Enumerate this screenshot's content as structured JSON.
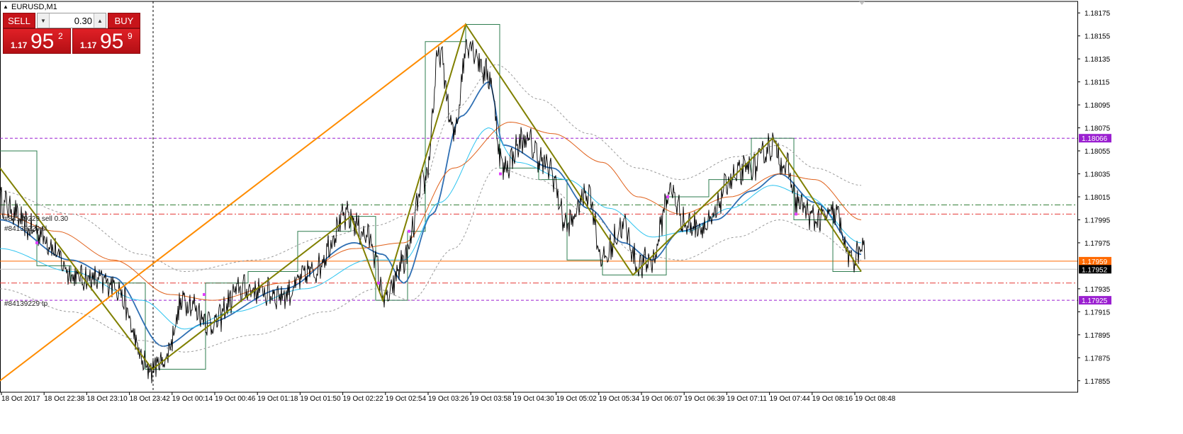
{
  "window": {
    "title": "EURUSD,M1",
    "symbol_triangle": "▲"
  },
  "one_click_trading": {
    "sell_label": "SELL",
    "buy_label": "BUY",
    "lot_value": "0.30",
    "lot_down_glyph": "▼",
    "lot_up_glyph": "▲",
    "bid": {
      "prefix": "1.17",
      "big": "95",
      "sup": "2"
    },
    "ask": {
      "prefix": "1.17",
      "big": "95",
      "sup": "9"
    }
  },
  "order_labels": {
    "entry": "#84139229 sell 0.30",
    "sl": "#84139229 sl",
    "tp": "#84139229 tp"
  },
  "price_axis": {
    "ticks": [
      "1.18175",
      "1.18155",
      "1.18135",
      "1.18115",
      "1.18095",
      "1.18075",
      "1.18055",
      "1.18035",
      "1.18015",
      "1.17995",
      "1.17975",
      "1.17935",
      "1.17915",
      "1.17895",
      "1.17875",
      "1.17855"
    ],
    "tick_values": [
      1.18175,
      1.18155,
      1.18135,
      1.18115,
      1.18095,
      1.18075,
      1.18055,
      1.18035,
      1.18015,
      1.17995,
      1.17975,
      1.17935,
      1.17915,
      1.17895,
      1.17875,
      1.17855
    ],
    "badges": [
      {
        "name": "level-upper",
        "label": "1.18066",
        "value": 1.18066,
        "color": "#9a1fd0",
        "text_color": "#ffffff"
      },
      {
        "name": "ask-line",
        "label": "1.17959",
        "value": 1.17959,
        "color": "#ff6a00",
        "text_color": "#ffffff"
      },
      {
        "name": "bid-line",
        "label": "1.17952",
        "value": 1.17952,
        "color": "#000000",
        "text_color": "#ffffff"
      },
      {
        "name": "level-lower",
        "label": "1.17925",
        "value": 1.17925,
        "color": "#9a1fd0",
        "text_color": "#ffffff"
      }
    ]
  },
  "time_axis": {
    "labels": [
      "18 Oct 2017",
      "18 Oct 22:38",
      "18 Oct 23:10",
      "18 Oct 23:42",
      "19 Oct 00:14",
      "19 Oct 00:46",
      "19 Oct 01:18",
      "19 Oct 01:50",
      "19 Oct 02:22",
      "19 Oct 02:54",
      "19 Oct 03:26",
      "19 Oct 03:58",
      "19 Oct 04:30",
      "19 Oct 05:02",
      "19 Oct 05:34",
      "19 Oct 06:07",
      "19 Oct 06:39",
      "19 Oct 07:11",
      "19 Oct 07:44",
      "19 Oct 08:16",
      "19 Oct 08:48"
    ]
  },
  "colors": {
    "background": "#ffffff",
    "price": "#000000",
    "zigzag": "#808000",
    "trendline": "#ff8c00",
    "ma_fast": "#2f6fb3",
    "ma_light": "#2ec4f0",
    "ma_orange": "#e0601a",
    "envelope": "#9a9a9a",
    "levels": "#9a1fd0",
    "entry": "#2e7d32",
    "sl_tp": "#e53935",
    "channel_box": "#2e7d4f",
    "marker": "#e040fb"
  },
  "chart_data": {
    "type": "line",
    "symbol": "EURUSD",
    "timeframe": "M1",
    "ylim": [
      1.17845,
      1.18185
    ],
    "grid": false,
    "hlines": [
      {
        "name": "resistance",
        "value": 1.18066,
        "style": "dashed",
        "color": "#9a1fd0"
      },
      {
        "name": "entry",
        "value": 1.18008,
        "style": "dashdot",
        "color": "#2e7d32"
      },
      {
        "name": "sl",
        "value": 1.18,
        "style": "dashdot",
        "color": "#e53935"
      },
      {
        "name": "ask",
        "value": 1.17959,
        "style": "solid",
        "color": "#ff6a00"
      },
      {
        "name": "bid",
        "value": 1.17952,
        "style": "solid",
        "color": "#c0c0c0"
      },
      {
        "name": "tp",
        "value": 1.1794,
        "style": "dashdot",
        "color": "#e53935"
      },
      {
        "name": "support",
        "value": 1.17925,
        "style": "dashed",
        "color": "#9a1fd0"
      }
    ],
    "price_series": {
      "name": "close",
      "anchors": [
        [
          0,
          1.1801
        ],
        [
          50,
          1.17985
        ],
        [
          110,
          1.17945
        ],
        [
          160,
          1.1794
        ],
        [
          210,
          1.17865
        ],
        [
          230,
          1.17872
        ],
        [
          260,
          1.17925
        ],
        [
          300,
          1.17905
        ],
        [
          340,
          1.17935
        ],
        [
          400,
          1.1793
        ],
        [
          440,
          1.1795
        ],
        [
          490,
          1.17998
        ],
        [
          520,
          1.1798
        ],
        [
          545,
          1.17925
        ],
        [
          570,
          1.1796
        ],
        [
          600,
          1.1803
        ],
        [
          620,
          1.1814
        ],
        [
          640,
          1.1807
        ],
        [
          660,
          1.1815
        ],
        [
          690,
          1.1812
        ],
        [
          710,
          1.1804
        ],
        [
          740,
          1.18065
        ],
        [
          775,
          1.1804
        ],
        [
          800,
          1.1799
        ],
        [
          830,
          1.1802
        ],
        [
          850,
          1.1796
        ],
        [
          880,
          1.1799
        ],
        [
          900,
          1.17955
        ],
        [
          920,
          1.1796
        ],
        [
          945,
          1.1802
        ],
        [
          970,
          1.1799
        ],
        [
          1000,
          1.1799
        ],
        [
          1030,
          1.1803
        ],
        [
          1060,
          1.1804
        ],
        [
          1090,
          1.1806
        ],
        [
          1110,
          1.1804
        ],
        [
          1125,
          1.1801
        ],
        [
          1150,
          1.17995
        ],
        [
          1180,
          1.18
        ],
        [
          1200,
          1.1796
        ],
        [
          1220,
          1.1797
        ]
      ]
    },
    "zigzag": [
      [
        0,
        1.1804
      ],
      [
        215,
        1.17865
      ],
      [
        495,
        1.17998
      ],
      [
        540,
        1.17925
      ],
      [
        657,
        1.18165
      ],
      [
        893,
        1.17947
      ],
      [
        1090,
        1.18066
      ],
      [
        1215,
        1.1795
      ]
    ],
    "trendline": [
      [
        0,
        1.17855
      ],
      [
        657,
        1.18165
      ]
    ],
    "moving_averages": [
      {
        "name": "ma_fast",
        "color": "#2f6fb3",
        "width": 1.8,
        "anchors": [
          [
            0,
            1.17995
          ],
          [
            100,
            1.1796
          ],
          [
            160,
            1.17945
          ],
          [
            230,
            1.17885
          ],
          [
            290,
            1.17905
          ],
          [
            400,
            1.17935
          ],
          [
            500,
            1.17975
          ],
          [
            540,
            1.17965
          ],
          [
            570,
            1.1794
          ],
          [
            610,
            1.18
          ],
          [
            650,
            1.18085
          ],
          [
            690,
            1.18115
          ],
          [
            710,
            1.1806
          ],
          [
            780,
            1.1804
          ],
          [
            830,
            1.18005
          ],
          [
            880,
            1.17975
          ],
          [
            920,
            1.1796
          ],
          [
            960,
            1.17985
          ],
          [
            1010,
            1.17995
          ],
          [
            1060,
            1.1802
          ],
          [
            1100,
            1.18035
          ],
          [
            1150,
            1.1801
          ],
          [
            1215,
            1.17965
          ]
        ]
      },
      {
        "name": "ma_light",
        "color": "#2ec4f0",
        "width": 1,
        "anchors": [
          [
            0,
            1.1797
          ],
          [
            100,
            1.1795
          ],
          [
            200,
            1.17925
          ],
          [
            260,
            1.179
          ],
          [
            330,
            1.17915
          ],
          [
            430,
            1.17935
          ],
          [
            520,
            1.1796
          ],
          [
            570,
            1.1796
          ],
          [
            620,
            1.1801
          ],
          [
            690,
            1.18075
          ],
          [
            730,
            1.18045
          ],
          [
            800,
            1.1803
          ],
          [
            860,
            1.18005
          ],
          [
            920,
            1.1798
          ],
          [
            970,
            1.17985
          ],
          [
            1030,
            1.18005
          ],
          [
            1090,
            1.18025
          ],
          [
            1140,
            1.18015
          ],
          [
            1215,
            1.17975
          ]
        ]
      },
      {
        "name": "ma_orange",
        "color": "#e0601a",
        "width": 1,
        "anchors": [
          [
            0,
            1.18
          ],
          [
            80,
            1.17985
          ],
          [
            160,
            1.1796
          ],
          [
            240,
            1.1793
          ],
          [
            300,
            1.17925
          ],
          [
            400,
            1.1794
          ],
          [
            500,
            1.1797
          ],
          [
            570,
            1.17975
          ],
          [
            640,
            1.1804
          ],
          [
            720,
            1.1808
          ],
          [
            780,
            1.1807
          ],
          [
            850,
            1.18045
          ],
          [
            900,
            1.18015
          ],
          [
            960,
            1.18
          ],
          [
            1030,
            1.18015
          ],
          [
            1100,
            1.18035
          ],
          [
            1150,
            1.1803
          ],
          [
            1215,
            1.17995
          ]
        ]
      },
      {
        "name": "envelope_upper",
        "color": "#9a9a9a",
        "width": 1,
        "dashed": true,
        "anchors": [
          [
            0,
            1.1802
          ],
          [
            100,
            1.18
          ],
          [
            200,
            1.17965
          ],
          [
            260,
            1.1795
          ],
          [
            360,
            1.1796
          ],
          [
            460,
            1.1798
          ],
          [
            530,
            1.1799
          ],
          [
            580,
            1.18
          ],
          [
            640,
            1.1809
          ],
          [
            700,
            1.1813
          ],
          [
            760,
            1.181
          ],
          [
            830,
            1.1807
          ],
          [
            900,
            1.1804
          ],
          [
            960,
            1.1803
          ],
          [
            1040,
            1.1805
          ],
          [
            1100,
            1.1806
          ],
          [
            1150,
            1.1804
          ],
          [
            1215,
            1.18025
          ]
        ]
      },
      {
        "name": "envelope_lower",
        "color": "#9a9a9a",
        "width": 1,
        "dashed": true,
        "anchors": [
          [
            0,
            1.17935
          ],
          [
            100,
            1.17915
          ],
          [
            200,
            1.1789
          ],
          [
            260,
            1.1788
          ],
          [
            360,
            1.17895
          ],
          [
            460,
            1.17915
          ],
          [
            530,
            1.17935
          ],
          [
            580,
            1.17925
          ],
          [
            640,
            1.1797
          ],
          [
            700,
            1.1804
          ],
          [
            760,
            1.1803
          ],
          [
            830,
            1.18
          ],
          [
            900,
            1.17965
          ],
          [
            960,
            1.1796
          ],
          [
            1040,
            1.1798
          ],
          [
            1100,
            1.17995
          ],
          [
            1150,
            1.17985
          ],
          [
            1215,
            1.1796
          ]
        ]
      }
    ],
    "channel_steps": [
      [
        0,
        1.18055
      ],
      [
        52,
        1.18055
      ],
      [
        52,
        1.17955
      ],
      [
        100,
        1.17955
      ],
      [
        100,
        1.1794
      ],
      [
        205,
        1.1794
      ],
      [
        205,
        1.17865
      ],
      [
        290,
        1.17865
      ],
      [
        290,
        1.1794
      ],
      [
        350,
        1.1794
      ],
      [
        350,
        1.1795
      ],
      [
        420,
        1.1795
      ],
      [
        420,
        1.17985
      ],
      [
        495,
        1.17985
      ],
      [
        495,
        1.17998
      ],
      [
        530,
        1.17998
      ],
      [
        530,
        1.17925
      ],
      [
        575,
        1.17925
      ],
      [
        575,
        1.17985
      ],
      [
        600,
        1.17985
      ],
      [
        600,
        1.1815
      ],
      [
        657,
        1.1815
      ],
      [
        657,
        1.18165
      ],
      [
        705,
        1.18165
      ],
      [
        705,
        1.1804
      ],
      [
        760,
        1.1804
      ],
      [
        760,
        1.1803
      ],
      [
        800,
        1.1803
      ],
      [
        800,
        1.1796
      ],
      [
        850,
        1.1796
      ],
      [
        850,
        1.17947
      ],
      [
        940,
        1.17947
      ],
      [
        940,
        1.18015
      ],
      [
        1000,
        1.18015
      ],
      [
        1000,
        1.1803
      ],
      [
        1060,
        1.1803
      ],
      [
        1060,
        1.18066
      ],
      [
        1120,
        1.18066
      ],
      [
        1120,
        1.17995
      ],
      [
        1175,
        1.17995
      ],
      [
        1175,
        1.1795
      ],
      [
        1215,
        1.1795
      ]
    ],
    "markers": [
      [
        52,
        1.17975
      ],
      [
        288,
        1.1793
      ],
      [
        534,
        1.1794
      ],
      [
        577,
        1.17985
      ],
      [
        706,
        1.18035
      ],
      [
        942,
        1.18015
      ],
      [
        1123,
        1.18
      ]
    ]
  }
}
